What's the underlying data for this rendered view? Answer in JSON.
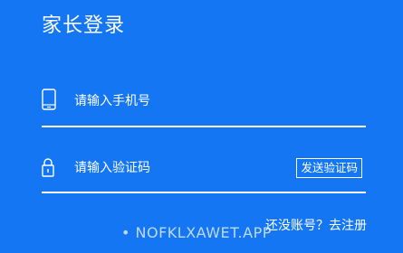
{
  "header": {
    "title": "家长登录"
  },
  "phone": {
    "placeholder": "请输入手机号",
    "icon": "phone-icon"
  },
  "code": {
    "placeholder": "请输入验证码",
    "icon": "lock-icon",
    "send_label": "发送验证码"
  },
  "footer": {
    "prompt": "还没账号？",
    "register_label": "去注册"
  },
  "watermark": {
    "text": "• NOFKLXAWET.APP"
  },
  "colors": {
    "background": "#1476f2",
    "foreground": "#ffffff"
  }
}
